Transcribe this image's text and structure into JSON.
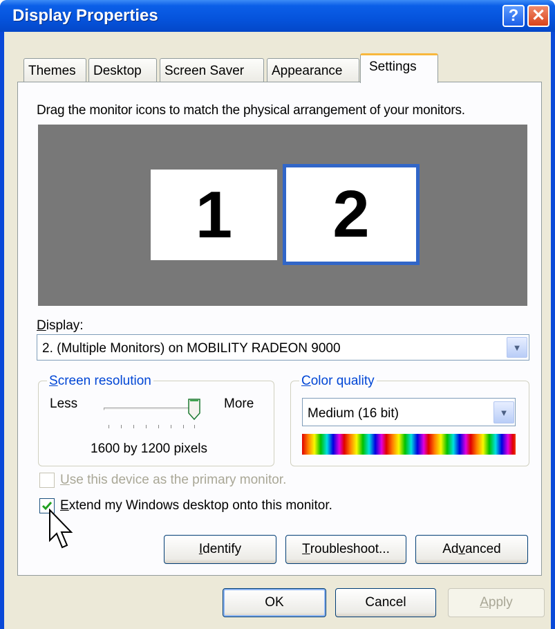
{
  "window": {
    "title": "Display Properties",
    "help": "?",
    "close": "✕"
  },
  "tabs": [
    "Themes",
    "Desktop",
    "Screen Saver",
    "Appearance",
    "Settings"
  ],
  "active_tab": "Settings",
  "instructions": "Drag the monitor icons to match the physical arrangement of your monitors.",
  "monitors": [
    "1",
    "2"
  ],
  "display": {
    "label": "Display:",
    "value": "2. (Multiple Monitors) on MOBILITY RADEON 9000"
  },
  "resolution": {
    "legend": "Screen resolution",
    "less": "Less",
    "more": "More",
    "value": "1600 by 1200 pixels",
    "slider_fraction": 1.0
  },
  "color": {
    "legend": "Color quality",
    "value": "Medium (16 bit)"
  },
  "options": {
    "primary": {
      "label": "Use this device as the primary monitor.",
      "checked": false,
      "enabled": false
    },
    "extend": {
      "label": "Extend my Windows desktop onto this monitor.",
      "checked": true,
      "enabled": true
    }
  },
  "panel_buttons": {
    "identify": "Identify",
    "troubleshoot": "Troubleshoot...",
    "advanced": "Advanced"
  },
  "dialog_buttons": {
    "ok": "OK",
    "cancel": "Cancel",
    "apply": "Apply"
  },
  "colors": {
    "titlebar": "#0553dc",
    "accent": "#0046d5",
    "tab_highlight": "#f8b73c",
    "selected_monitor_border": "#3166c8"
  }
}
